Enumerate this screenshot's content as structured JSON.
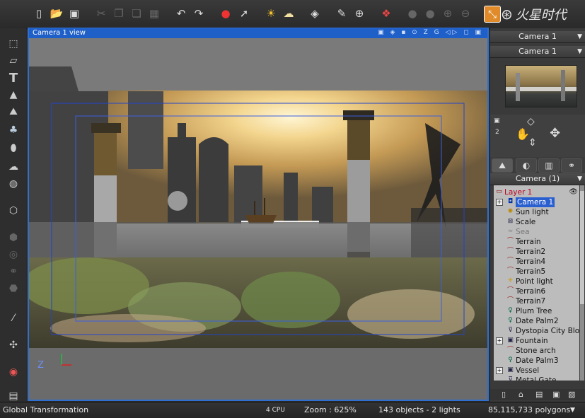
{
  "toolbar": {
    "icons": [
      "new-file",
      "open-file",
      "save",
      "cut",
      "copy",
      "paste",
      "delete",
      "undo",
      "redo",
      "render",
      "render-area",
      "atmosphere",
      "clouds",
      "object-editor",
      "edit-material",
      "color-picker",
      "layout"
    ],
    "logo": "火星时代"
  },
  "viewport": {
    "title": "Camera 1 view",
    "title_icons": [
      "camera-icon",
      "render-icon",
      "options",
      "zoom",
      "grid",
      "pan",
      "fullscreen"
    ],
    "axis_z": "Z"
  },
  "right_panel": {
    "camera_select": "Camera 1",
    "camera_preview_label": "Camera 1",
    "nav_number": "2",
    "tree_header": "Camera (1)",
    "tree": [
      {
        "label": "Layer 1",
        "type": "layer",
        "indent": 0
      },
      {
        "label": "Camera 1",
        "type": "camera",
        "indent": 1,
        "selected": true,
        "expand": "+"
      },
      {
        "label": "Sun light",
        "type": "sun",
        "indent": 1
      },
      {
        "label": "Scale",
        "type": "scale",
        "indent": 1
      },
      {
        "label": "Sea",
        "type": "sea",
        "indent": 1,
        "dim": true
      },
      {
        "label": "Terrain",
        "type": "terrain",
        "indent": 1
      },
      {
        "label": "Terrain2",
        "type": "terrain",
        "indent": 1
      },
      {
        "label": "Terrain4",
        "type": "terrain",
        "indent": 1
      },
      {
        "label": "Terrain5",
        "type": "terrain",
        "indent": 1
      },
      {
        "label": "Point light",
        "type": "light",
        "indent": 1
      },
      {
        "label": "Terrain6",
        "type": "terrain",
        "indent": 1
      },
      {
        "label": "Terrain7",
        "type": "terrain",
        "indent": 1
      },
      {
        "label": "Plum Tree",
        "type": "tree",
        "indent": 1
      },
      {
        "label": "Date Palm2",
        "type": "tree",
        "indent": 1
      },
      {
        "label": "Dystopia City Block",
        "type": "object",
        "indent": 1
      },
      {
        "label": "Fountain",
        "type": "group",
        "indent": 1,
        "expand": "+"
      },
      {
        "label": "Stone arch",
        "type": "terrain",
        "indent": 1
      },
      {
        "label": "Date Palm3",
        "type": "tree",
        "indent": 1
      },
      {
        "label": "Vessel",
        "type": "group",
        "indent": 1,
        "expand": "+"
      },
      {
        "label": "Metal Gate",
        "type": "object",
        "indent": 1
      }
    ]
  },
  "status": {
    "mode": "Global Transformation",
    "cpu": "4 CPU",
    "zoom": "Zoom : 625%",
    "objects": "143 objects - 2 lights",
    "polygons": "85,115,733 polygons"
  }
}
